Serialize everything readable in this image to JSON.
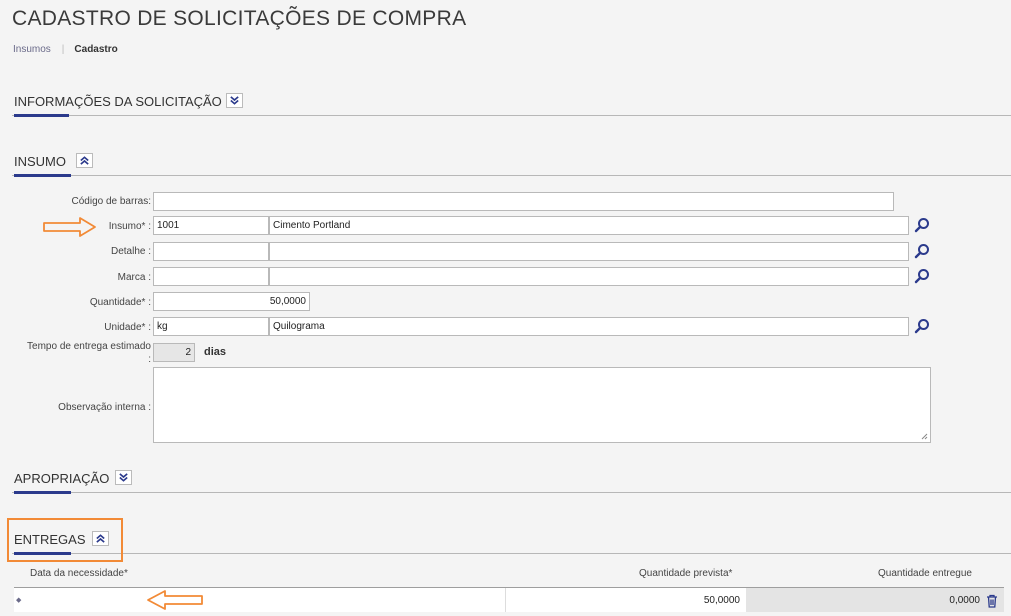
{
  "page": {
    "title": "CADASTRO DE SOLICITAÇÕES DE COMPRA"
  },
  "breadcrumb": {
    "link": "Insumos",
    "separator": "|",
    "current": "Cadastro"
  },
  "sections": {
    "info": {
      "title": "INFORMAÇÕES DA SOLICITAÇÃO",
      "state": "collapsed"
    },
    "insumo": {
      "title": "INSUMO",
      "state": "expanded"
    },
    "apropriacao": {
      "title": "APROPRIAÇÃO",
      "state": "collapsed"
    },
    "entregas": {
      "title": "ENTREGAS",
      "state": "expanded"
    }
  },
  "form": {
    "barcode": {
      "label": "Código de barras:",
      "value": ""
    },
    "insumo": {
      "label": "Insumo* :",
      "code": "1001",
      "name": "Cimento Portland"
    },
    "detalhe": {
      "label": "Detalhe :",
      "code": "",
      "name": ""
    },
    "marca": {
      "label": "Marca :",
      "code": "",
      "name": ""
    },
    "quantidade": {
      "label": "Quantidade* :",
      "value": "50,0000"
    },
    "unidade": {
      "label": "Unidade* :",
      "code": "kg",
      "name": "Quilograma"
    },
    "tempo": {
      "label_line1": "Tempo de entrega estimado",
      "label_line2": ":",
      "value": "2",
      "unit": "dias"
    },
    "observacao": {
      "label": "Observação interna :",
      "value": ""
    }
  },
  "entregas_table": {
    "columns": [
      "Data da necessidade*",
      "Quantidade prevista*",
      "Quantidade entregue"
    ],
    "rows": [
      {
        "marker": "◆",
        "data": "",
        "prevista": "50,0000",
        "entregue": "0,0000"
      }
    ]
  },
  "colors": {
    "accent": "#2b3a8c",
    "highlight": "#f28a36",
    "icon": "#2b3a8c"
  }
}
